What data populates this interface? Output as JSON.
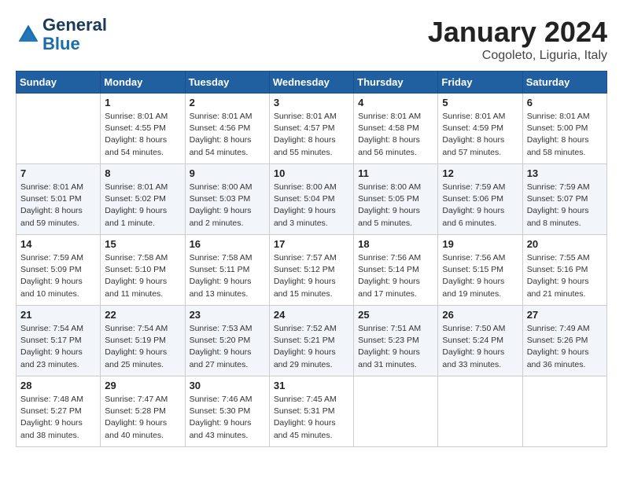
{
  "header": {
    "logo_line1": "General",
    "logo_line2": "Blue",
    "month": "January 2024",
    "location": "Cogoleto, Liguria, Italy"
  },
  "days_of_week": [
    "Sunday",
    "Monday",
    "Tuesday",
    "Wednesday",
    "Thursday",
    "Friday",
    "Saturday"
  ],
  "weeks": [
    [
      {
        "day": "",
        "info": ""
      },
      {
        "day": "1",
        "info": "Sunrise: 8:01 AM\nSunset: 4:55 PM\nDaylight: 8 hours\nand 54 minutes."
      },
      {
        "day": "2",
        "info": "Sunrise: 8:01 AM\nSunset: 4:56 PM\nDaylight: 8 hours\nand 54 minutes."
      },
      {
        "day": "3",
        "info": "Sunrise: 8:01 AM\nSunset: 4:57 PM\nDaylight: 8 hours\nand 55 minutes."
      },
      {
        "day": "4",
        "info": "Sunrise: 8:01 AM\nSunset: 4:58 PM\nDaylight: 8 hours\nand 56 minutes."
      },
      {
        "day": "5",
        "info": "Sunrise: 8:01 AM\nSunset: 4:59 PM\nDaylight: 8 hours\nand 57 minutes."
      },
      {
        "day": "6",
        "info": "Sunrise: 8:01 AM\nSunset: 5:00 PM\nDaylight: 8 hours\nand 58 minutes."
      }
    ],
    [
      {
        "day": "7",
        "info": "Sunrise: 8:01 AM\nSunset: 5:01 PM\nDaylight: 8 hours\nand 59 minutes."
      },
      {
        "day": "8",
        "info": "Sunrise: 8:01 AM\nSunset: 5:02 PM\nDaylight: 9 hours\nand 1 minute."
      },
      {
        "day": "9",
        "info": "Sunrise: 8:00 AM\nSunset: 5:03 PM\nDaylight: 9 hours\nand 2 minutes."
      },
      {
        "day": "10",
        "info": "Sunrise: 8:00 AM\nSunset: 5:04 PM\nDaylight: 9 hours\nand 3 minutes."
      },
      {
        "day": "11",
        "info": "Sunrise: 8:00 AM\nSunset: 5:05 PM\nDaylight: 9 hours\nand 5 minutes."
      },
      {
        "day": "12",
        "info": "Sunrise: 7:59 AM\nSunset: 5:06 PM\nDaylight: 9 hours\nand 6 minutes."
      },
      {
        "day": "13",
        "info": "Sunrise: 7:59 AM\nSunset: 5:07 PM\nDaylight: 9 hours\nand 8 minutes."
      }
    ],
    [
      {
        "day": "14",
        "info": "Sunrise: 7:59 AM\nSunset: 5:09 PM\nDaylight: 9 hours\nand 10 minutes."
      },
      {
        "day": "15",
        "info": "Sunrise: 7:58 AM\nSunset: 5:10 PM\nDaylight: 9 hours\nand 11 minutes."
      },
      {
        "day": "16",
        "info": "Sunrise: 7:58 AM\nSunset: 5:11 PM\nDaylight: 9 hours\nand 13 minutes."
      },
      {
        "day": "17",
        "info": "Sunrise: 7:57 AM\nSunset: 5:12 PM\nDaylight: 9 hours\nand 15 minutes."
      },
      {
        "day": "18",
        "info": "Sunrise: 7:56 AM\nSunset: 5:14 PM\nDaylight: 9 hours\nand 17 minutes."
      },
      {
        "day": "19",
        "info": "Sunrise: 7:56 AM\nSunset: 5:15 PM\nDaylight: 9 hours\nand 19 minutes."
      },
      {
        "day": "20",
        "info": "Sunrise: 7:55 AM\nSunset: 5:16 PM\nDaylight: 9 hours\nand 21 minutes."
      }
    ],
    [
      {
        "day": "21",
        "info": "Sunrise: 7:54 AM\nSunset: 5:17 PM\nDaylight: 9 hours\nand 23 minutes."
      },
      {
        "day": "22",
        "info": "Sunrise: 7:54 AM\nSunset: 5:19 PM\nDaylight: 9 hours\nand 25 minutes."
      },
      {
        "day": "23",
        "info": "Sunrise: 7:53 AM\nSunset: 5:20 PM\nDaylight: 9 hours\nand 27 minutes."
      },
      {
        "day": "24",
        "info": "Sunrise: 7:52 AM\nSunset: 5:21 PM\nDaylight: 9 hours\nand 29 minutes."
      },
      {
        "day": "25",
        "info": "Sunrise: 7:51 AM\nSunset: 5:23 PM\nDaylight: 9 hours\nand 31 minutes."
      },
      {
        "day": "26",
        "info": "Sunrise: 7:50 AM\nSunset: 5:24 PM\nDaylight: 9 hours\nand 33 minutes."
      },
      {
        "day": "27",
        "info": "Sunrise: 7:49 AM\nSunset: 5:26 PM\nDaylight: 9 hours\nand 36 minutes."
      }
    ],
    [
      {
        "day": "28",
        "info": "Sunrise: 7:48 AM\nSunset: 5:27 PM\nDaylight: 9 hours\nand 38 minutes."
      },
      {
        "day": "29",
        "info": "Sunrise: 7:47 AM\nSunset: 5:28 PM\nDaylight: 9 hours\nand 40 minutes."
      },
      {
        "day": "30",
        "info": "Sunrise: 7:46 AM\nSunset: 5:30 PM\nDaylight: 9 hours\nand 43 minutes."
      },
      {
        "day": "31",
        "info": "Sunrise: 7:45 AM\nSunset: 5:31 PM\nDaylight: 9 hours\nand 45 minutes."
      },
      {
        "day": "",
        "info": ""
      },
      {
        "day": "",
        "info": ""
      },
      {
        "day": "",
        "info": ""
      }
    ]
  ]
}
